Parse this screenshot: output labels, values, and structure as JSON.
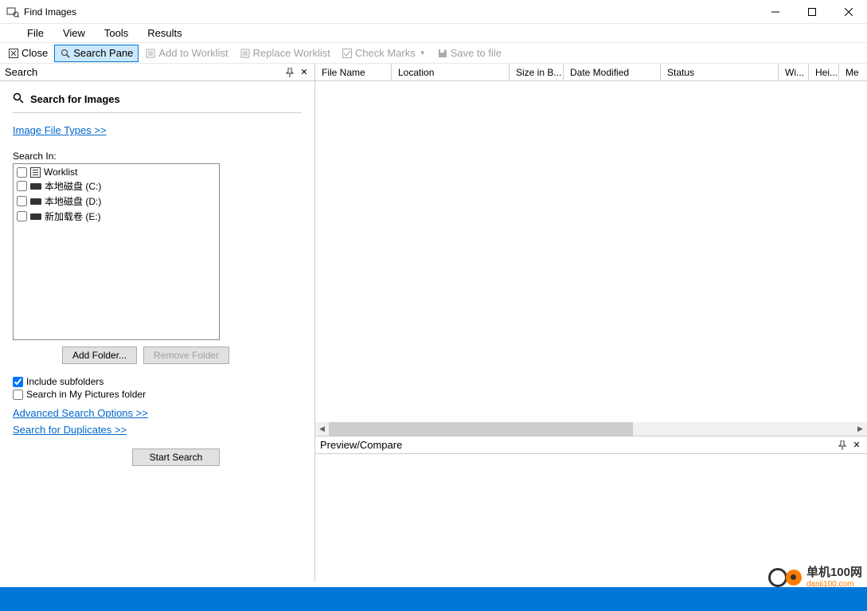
{
  "window": {
    "title": "Find Images"
  },
  "menu": {
    "file": "File",
    "view": "View",
    "tools": "Tools",
    "results": "Results"
  },
  "toolbar": {
    "close": "Close",
    "search_pane": "Search Pane",
    "add_worklist": "Add to Worklist",
    "replace_worklist": "Replace Worklist",
    "check_marks": "Check Marks",
    "save_file": "Save to file"
  },
  "left": {
    "panel_title": "Search",
    "section_title": "Search for Images",
    "file_types_link": "Image File Types >>",
    "search_in_label": "Search In:",
    "folders": [
      {
        "label": "Worklist",
        "type": "worklist",
        "checked": false
      },
      {
        "label": "本地磁盘 (C:)",
        "type": "drive",
        "checked": false
      },
      {
        "label": "本地磁盘 (D:)",
        "type": "drive",
        "checked": false
      },
      {
        "label": "新加载卷 (E:)",
        "type": "drive",
        "checked": false
      }
    ],
    "add_folder": "Add Folder...",
    "remove_folder": "Remove Folder",
    "include_subfolders": "Include subfolders",
    "search_my_pictures": "Search in My Pictures folder",
    "advanced_link": "Advanced Search Options >>",
    "duplicates_link": "Search for Duplicates >>",
    "start_search": "Start Search"
  },
  "table": {
    "columns": {
      "file_name": "File Name",
      "location": "Location",
      "size": "Size in B...",
      "date_modified": "Date Modified",
      "status": "Status",
      "width": "Wi...",
      "height": "Hei...",
      "me": "Me"
    }
  },
  "preview": {
    "title": "Preview/Compare"
  },
  "watermark": {
    "cn": "单机100网",
    "en": "danji100.com"
  }
}
